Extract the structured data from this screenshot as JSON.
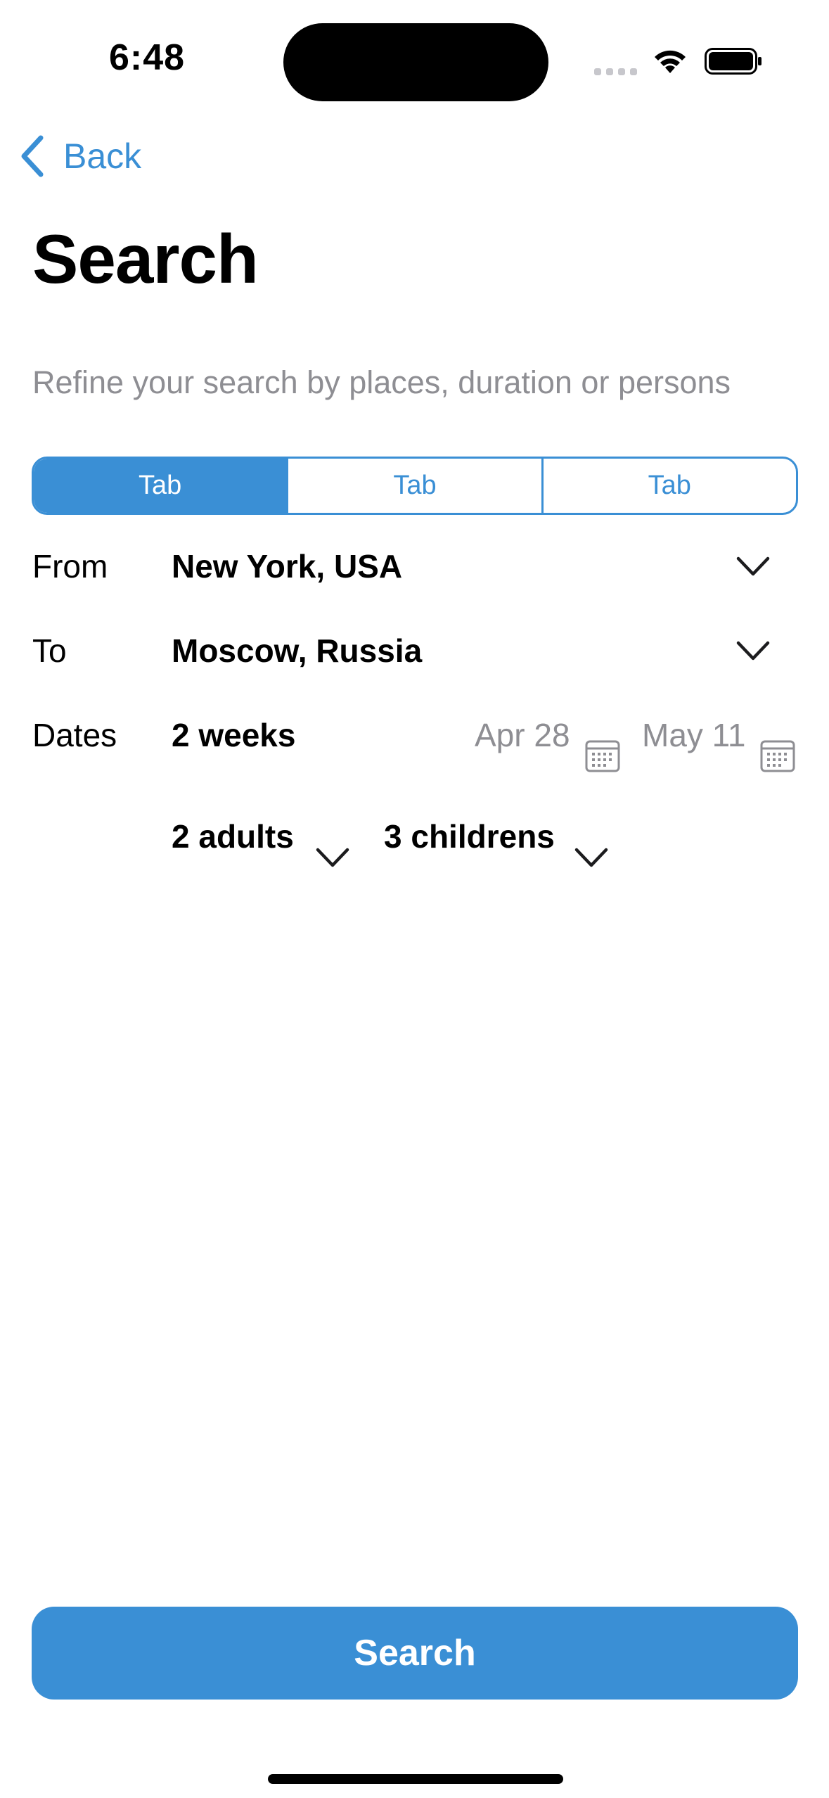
{
  "status_bar": {
    "time": "6:48"
  },
  "nav": {
    "back_label": "Back",
    "title": "Search",
    "subtitle": "Refine your search by places, duration or persons"
  },
  "tabs": [
    {
      "label": "Tab",
      "active": true
    },
    {
      "label": "Tab",
      "active": false
    },
    {
      "label": "Tab",
      "active": false
    }
  ],
  "form": {
    "from": {
      "label": "From",
      "value": "New York, USA"
    },
    "to": {
      "label": "To",
      "value": "Moscow, Russia"
    },
    "dates": {
      "label": "Dates",
      "duration": "2 weeks",
      "start": "Apr 28",
      "end": "May 11"
    },
    "guests": {
      "adults": "2 adults",
      "children": "3 childrens"
    }
  },
  "actions": {
    "search_label": "Search"
  },
  "colors": {
    "accent": "#3A8FD5",
    "secondary_text": "#8E8E93",
    "icon_gray": "#8E8E93"
  },
  "icons": [
    "chevron-left-icon",
    "chevron-down-icon",
    "calendar-icon",
    "wifi-icon",
    "battery-icon",
    "signal-icon"
  ]
}
